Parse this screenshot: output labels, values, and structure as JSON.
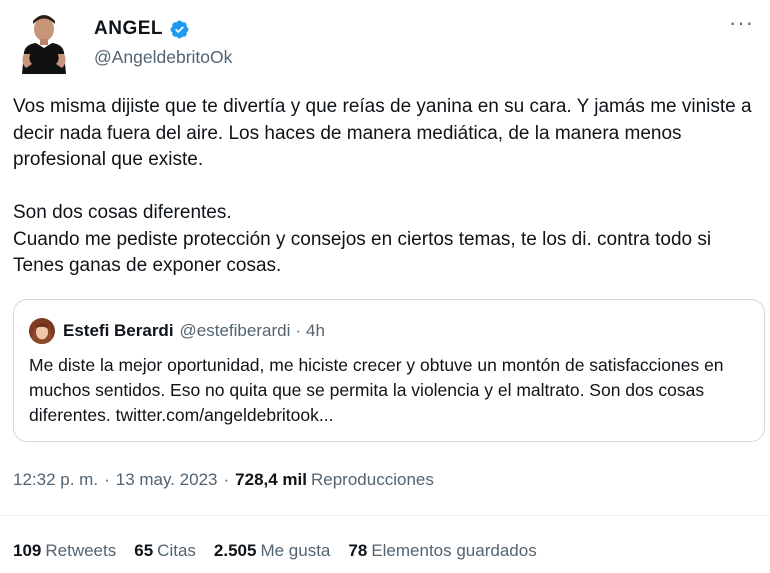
{
  "author": {
    "display_name": "ANGEL",
    "handle": "@AngeldebritoOk",
    "verified": true,
    "verified_color": "#1d9bf0"
  },
  "more_icon": "···",
  "tweet": {
    "text": "Vos misma dijiste que te divertía y que reías de yanina en su cara. Y jamás me viniste a decir nada fuera del aire. Los haces de manera mediática, de la manera menos profesional que existe.\n\nSon dos cosas diferentes.\nCuando me pediste protección y consejos en ciertos temas, te los di. contra todo si Tenes ganas de exponer cosas."
  },
  "quoted_tweet": {
    "name": "Estefi Berardi",
    "handle": "@estefiberardi",
    "dot": "·",
    "time": "4h",
    "text": "Me diste la mejor oportunidad, me hiciste crecer y obtuve un montón de satisfacciones en muchos sentidos. Eso no quita que se permita la violencia y el maltrato. Son dos cosas diferentes. twitter.com/angeldebritook..."
  },
  "meta": {
    "time": "12:32 p. m.",
    "sep1": "·",
    "date": "13 may. 2023",
    "sep2": "·",
    "views_count": "728,4 mil",
    "views_label": "Reproducciones"
  },
  "stats": {
    "retweets_count": "109",
    "retweets_label": "Retweets",
    "quotes_count": "65",
    "quotes_label": "Citas",
    "likes_count": "2.505",
    "likes_label": "Me gusta",
    "bookmarks_count": "78",
    "bookmarks_label": "Elementos guardados"
  },
  "colors": {
    "text_primary": "#0f1419",
    "text_secondary": "#536471",
    "border": "#cfd9de"
  }
}
